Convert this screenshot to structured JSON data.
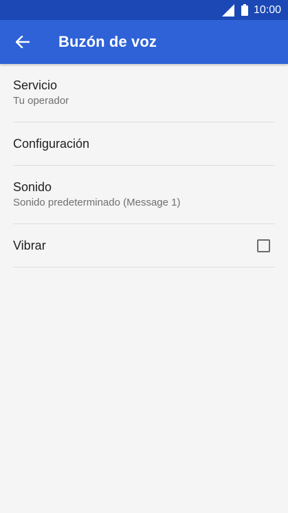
{
  "status_bar": {
    "time": "10:00",
    "icons": [
      "signal-icon",
      "battery-icon"
    ]
  },
  "app_bar": {
    "back_icon": "arrow-back-icon",
    "title": "Buzón de voz",
    "color": "#2f62d6",
    "status_color": "#1b48b5"
  },
  "settings": {
    "service": {
      "title": "Servicio",
      "summary": "Tu operador"
    },
    "configuration": {
      "title": "Configuración"
    },
    "sound": {
      "title": "Sonido",
      "summary": "Sonido predeterminado (Message 1)"
    },
    "vibrate": {
      "title": "Vibrar",
      "checked": false
    }
  }
}
